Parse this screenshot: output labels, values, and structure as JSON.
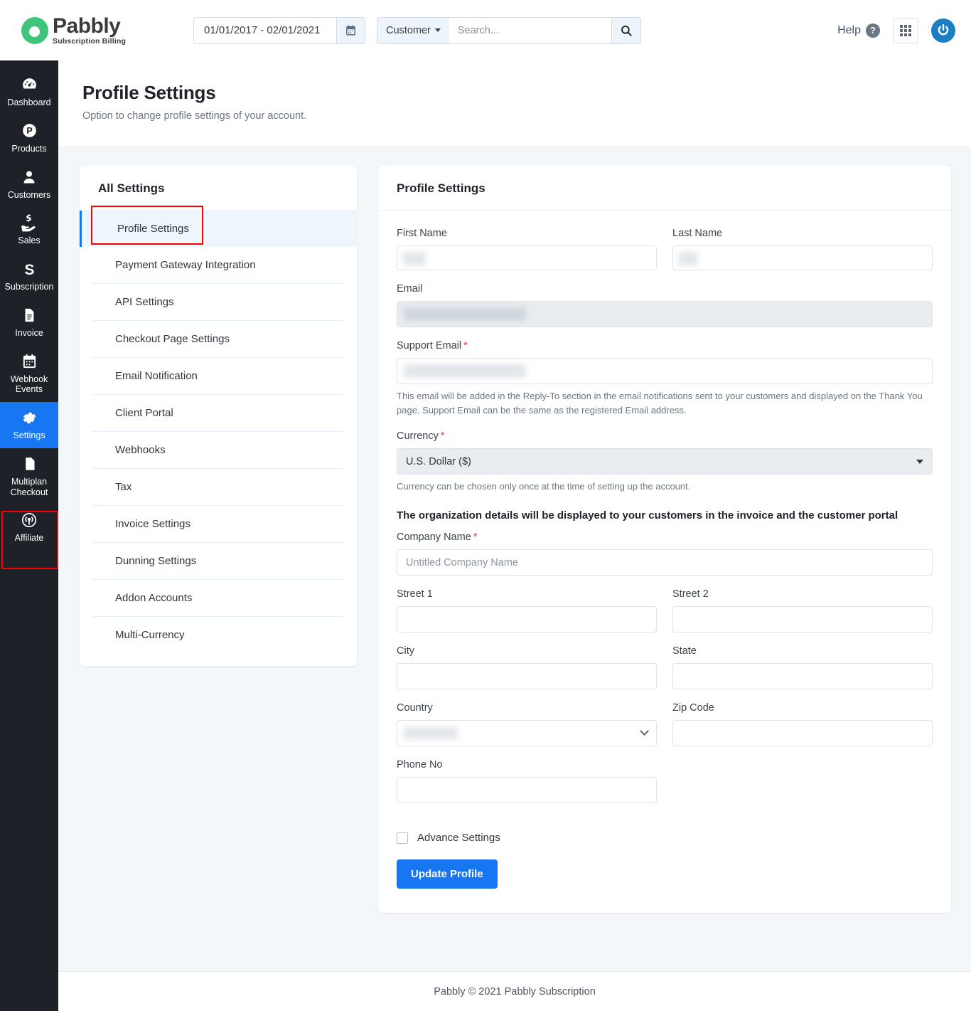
{
  "brand": {
    "name": "Pabbly",
    "tagline": "Subscription Billing",
    "logo_color": "#3fc47c"
  },
  "topbar": {
    "date_range": "01/01/2017 - 02/01/2021",
    "calendar_icon": "calendar-icon",
    "search_scope": "Customer",
    "search_placeholder": "Search...",
    "search_value": "",
    "search_icon": "search-icon",
    "help_label": "Help",
    "help_icon": "question-mark-icon",
    "apps_icon": "grid-apps-icon",
    "account_icon": "power-account-icon"
  },
  "sidebar": {
    "items": [
      {
        "label": "Dashboard",
        "icon": "speedometer-icon",
        "active": false
      },
      {
        "label": "Products",
        "icon": "product-p-icon",
        "active": false
      },
      {
        "label": "Customers",
        "icon": "user-icon",
        "active": false
      },
      {
        "label": "Sales",
        "icon": "hand-money-icon",
        "active": false
      },
      {
        "label": "Subscription",
        "icon": "letter-s-icon",
        "active": false
      },
      {
        "label": "Invoice",
        "icon": "document-icon",
        "active": false
      },
      {
        "label": "Webhook Events",
        "icon": "calendar-icon",
        "active": false
      },
      {
        "label": "Settings",
        "icon": "gear-icon",
        "active": true
      },
      {
        "label": "Multiplan Checkout",
        "icon": "page-icon",
        "active": false
      },
      {
        "label": "Affiliate",
        "icon": "broadcast-icon",
        "active": false
      }
    ],
    "active_color": "#1777f2",
    "highlight_color": "#ff0000"
  },
  "page": {
    "title": "Profile Settings",
    "subtitle": "Option to change profile settings of your account."
  },
  "settings_panel": {
    "title": "All Settings",
    "items": [
      {
        "label": "Profile Settings",
        "selected": true
      },
      {
        "label": "Payment Gateway Integration",
        "selected": false
      },
      {
        "label": "API Settings",
        "selected": false
      },
      {
        "label": "Checkout Page Settings",
        "selected": false
      },
      {
        "label": "Email Notification",
        "selected": false
      },
      {
        "label": "Client Portal",
        "selected": false
      },
      {
        "label": "Webhooks",
        "selected": false
      },
      {
        "label": "Tax",
        "selected": false
      },
      {
        "label": "Invoice Settings",
        "selected": false
      },
      {
        "label": "Dunning Settings",
        "selected": false
      },
      {
        "label": "Addon Accounts",
        "selected": false
      },
      {
        "label": "Multi-Currency",
        "selected": false
      }
    ]
  },
  "profile_form": {
    "title": "Profile Settings",
    "first_name": {
      "label": "First Name",
      "value": "",
      "redacted": true
    },
    "last_name": {
      "label": "Last Name",
      "value": "",
      "redacted": true
    },
    "email": {
      "label": "Email",
      "value": "",
      "redacted": true,
      "disabled": true
    },
    "support_email": {
      "label": "Support Email",
      "required": true,
      "value": "",
      "redacted": true,
      "help": "This email will be added in the Reply-To section in the email notifications sent to your customers and displayed on the Thank You page. Support Email can be the same as the registered Email address."
    },
    "currency": {
      "label": "Currency",
      "required": true,
      "value": "U.S. Dollar ($)",
      "help": "Currency can be chosen only once at the time of setting up the account."
    },
    "org_note": "The organization details will be displayed to your customers in the invoice and the customer portal",
    "company_name": {
      "label": "Company Name",
      "required": true,
      "value": "",
      "placeholder": "Untitled Company Name"
    },
    "street1": {
      "label": "Street 1",
      "value": ""
    },
    "street2": {
      "label": "Street 2",
      "value": ""
    },
    "city": {
      "label": "City",
      "value": ""
    },
    "state": {
      "label": "State",
      "value": ""
    },
    "country": {
      "label": "Country",
      "value": "",
      "redacted": true
    },
    "zip_code": {
      "label": "Zip Code",
      "value": ""
    },
    "phone_no": {
      "label": "Phone No",
      "value": ""
    },
    "advance_settings": {
      "label": "Advance Settings",
      "checked": false
    },
    "submit_label": "Update Profile"
  },
  "footer": {
    "text": "Pabbly © 2021 Pabbly Subscription"
  }
}
